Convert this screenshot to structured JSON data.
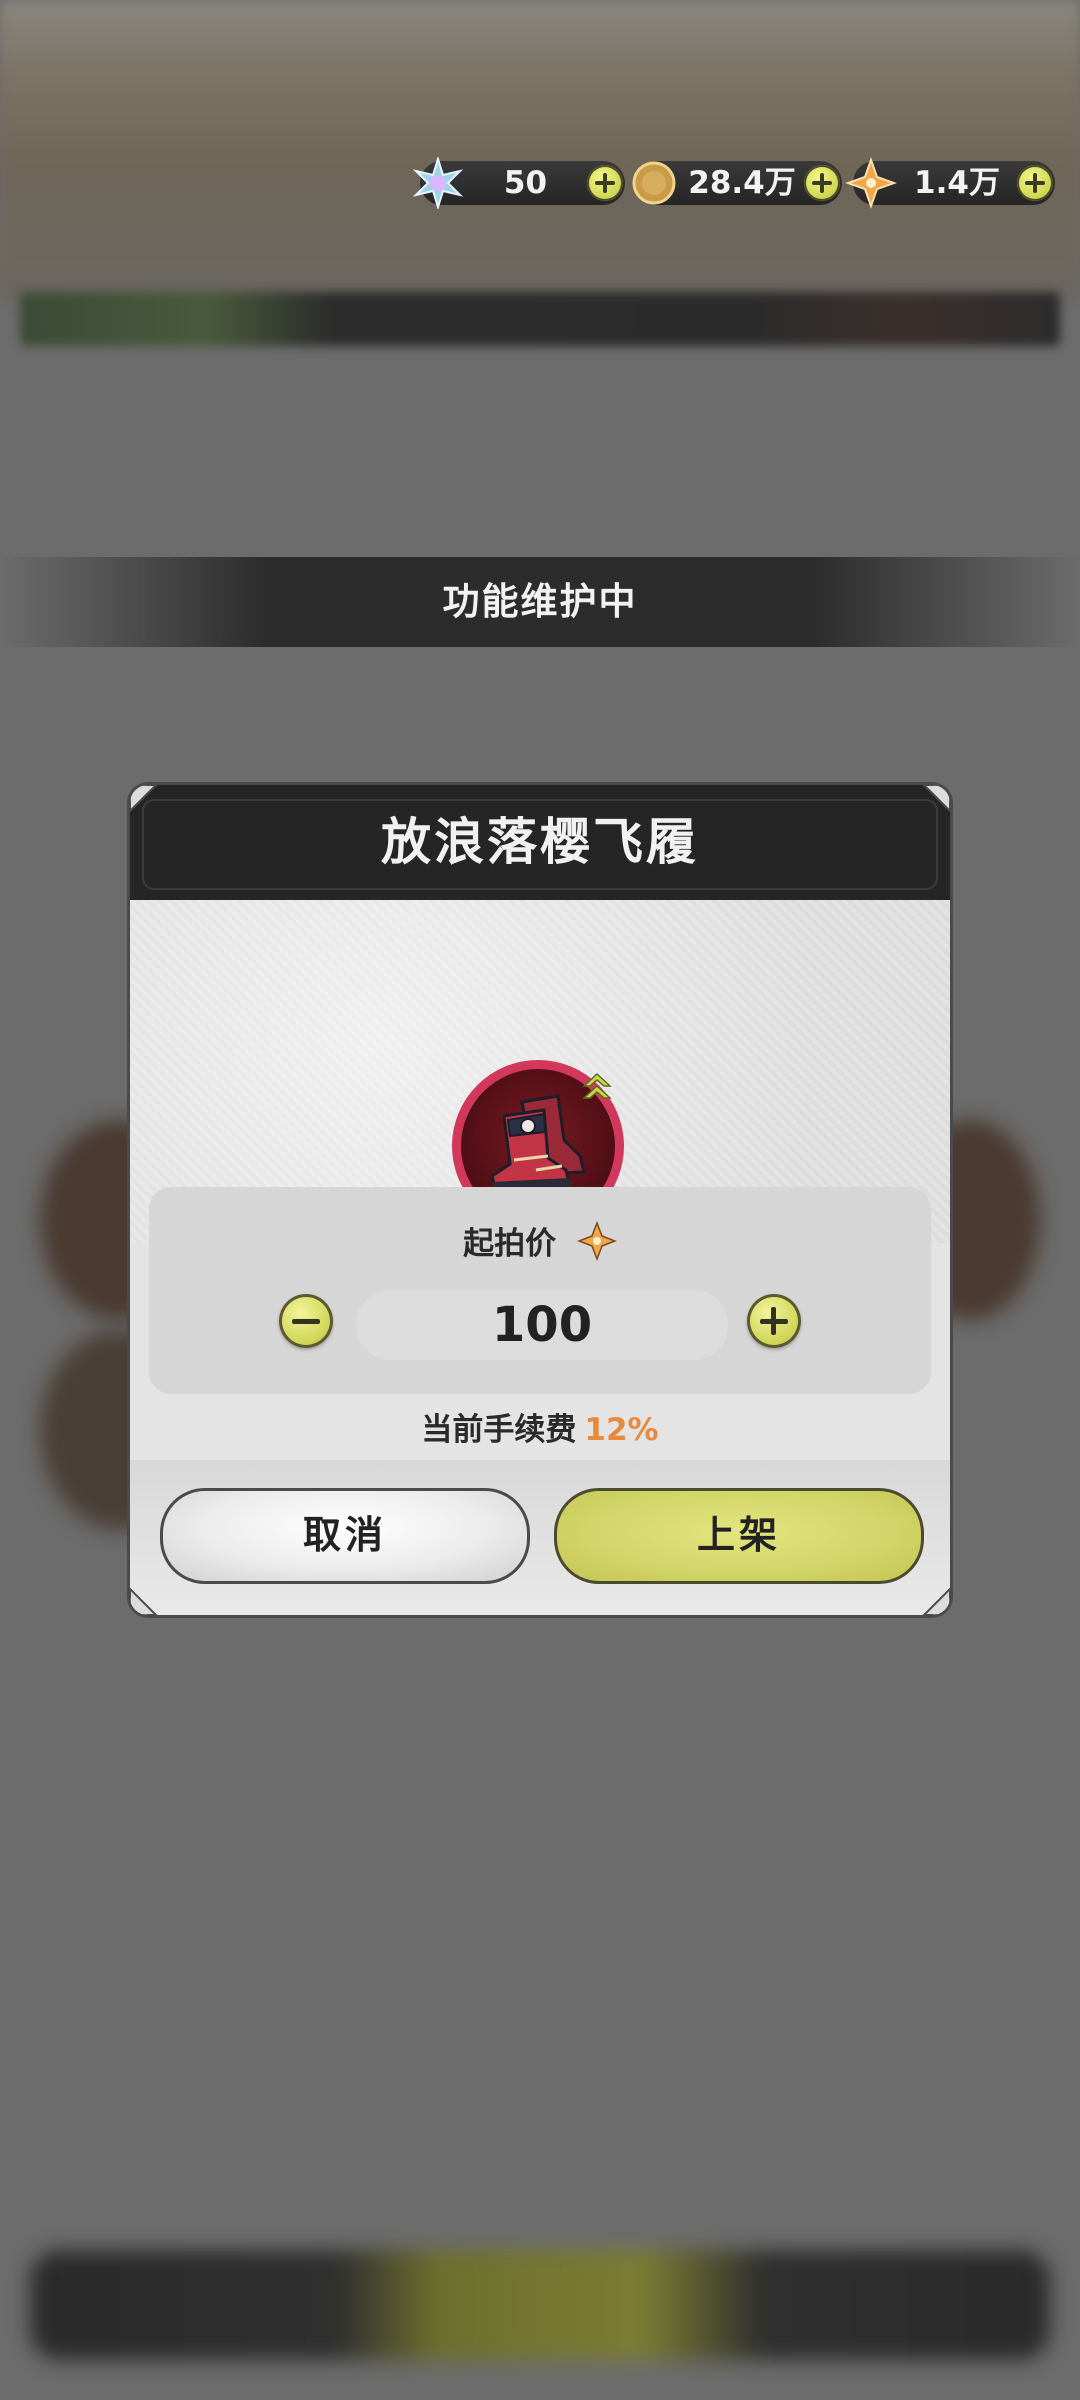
{
  "currencies": [
    {
      "name": "star-crystal",
      "value": "50"
    },
    {
      "name": "gold-coin",
      "value": "28.4万"
    },
    {
      "name": "amber-gem",
      "value": "1.4万"
    }
  ],
  "banner": {
    "text": "功能维护中"
  },
  "dialog": {
    "title": "放浪落樱飞履",
    "item_icon": "red-boots-icon",
    "price_label": "起拍价",
    "price_value": "100",
    "fee_label": "当前手续费",
    "fee_value": "12%",
    "cancel_label": "取消",
    "confirm_label": "上架"
  },
  "colors": {
    "accent_yellow": "#d3d66a",
    "fee_orange": "#e88a3e",
    "dialog_header": "#252525",
    "item_ring": "#d2375c"
  }
}
